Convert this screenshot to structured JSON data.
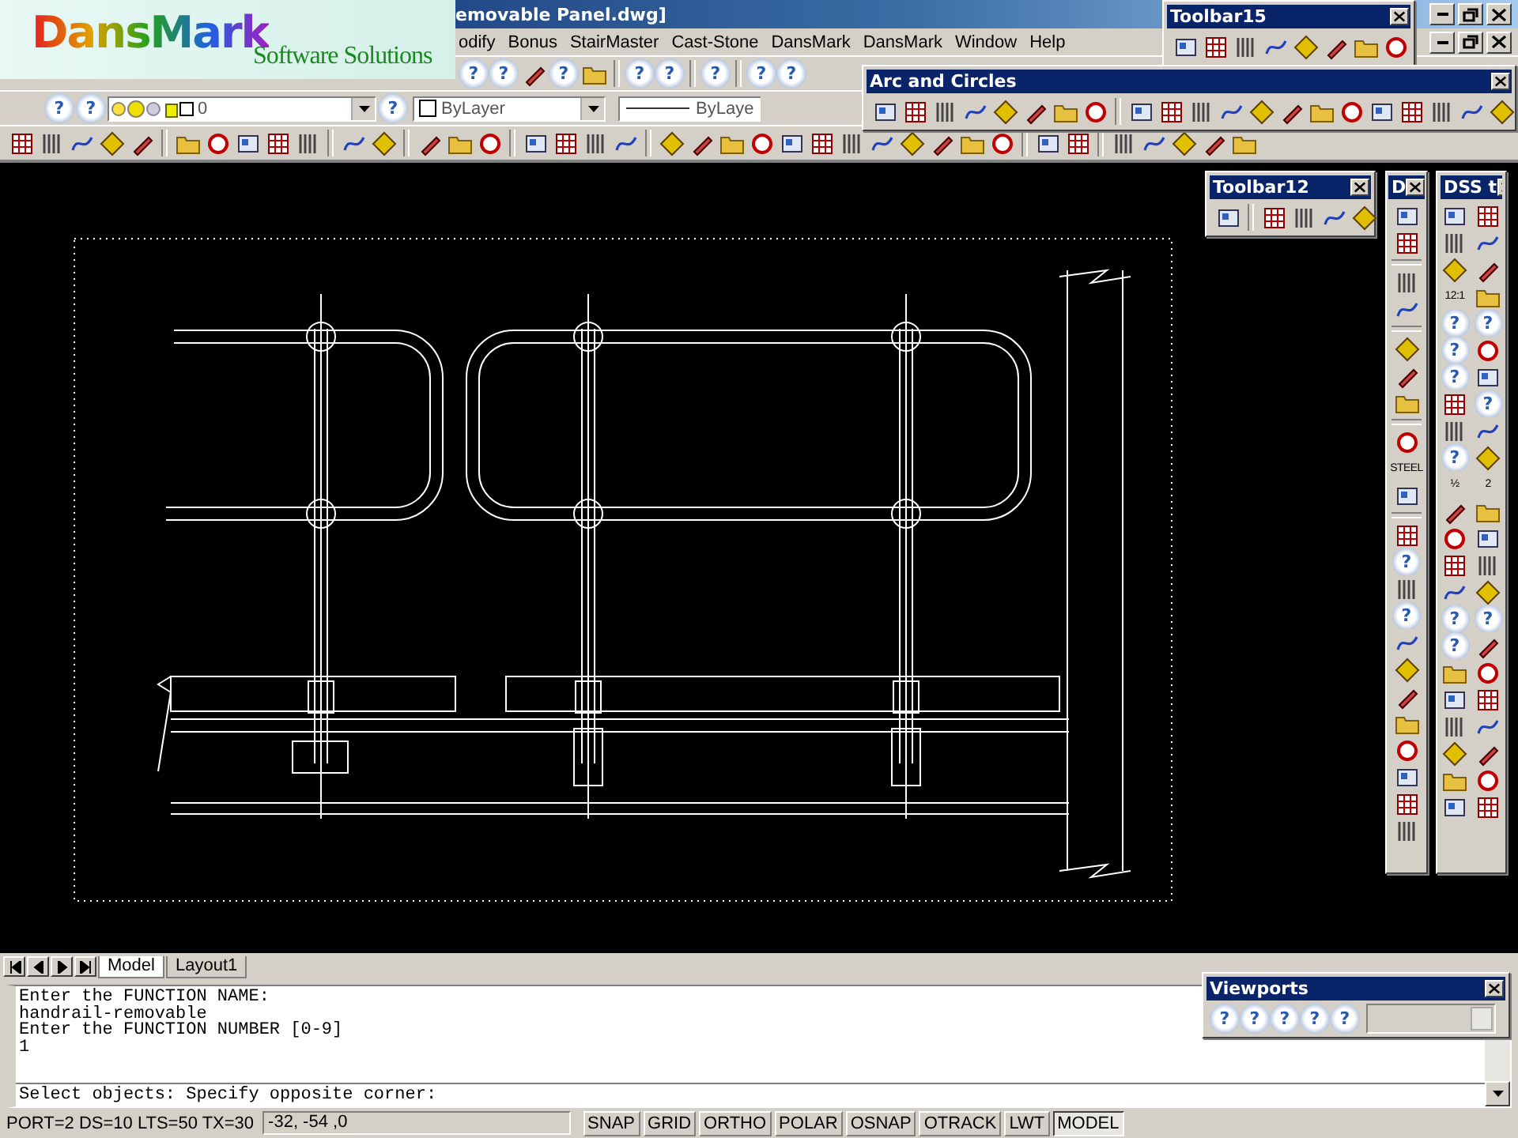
{
  "logo_overlay": {
    "brand": "DansMark",
    "tagline": "Software Solutions"
  },
  "window": {
    "title": "emovable Panel.dwg]"
  },
  "menu": [
    "odify",
    "Bonus",
    "StairMaster",
    "Cast-Stone",
    "DansMark",
    "DansMark",
    "Window",
    "Help"
  ],
  "standard_toolbar": {
    "items": [
      {
        "kind": "help",
        "label": "?"
      },
      {
        "kind": "help",
        "label": "?"
      },
      {
        "kind": "tool"
      },
      {
        "kind": "help",
        "label": "?"
      },
      {
        "kind": "tool"
      },
      {
        "kind": "sep"
      },
      {
        "kind": "help",
        "label": "?"
      },
      {
        "kind": "help",
        "label": "?"
      },
      {
        "kind": "sep"
      },
      {
        "kind": "help",
        "label": "?"
      },
      {
        "kind": "sep"
      },
      {
        "kind": "help",
        "label": "?"
      },
      {
        "kind": "help",
        "label": "?"
      }
    ]
  },
  "layers_toolbar": {
    "buttons": [
      "?",
      "?"
    ],
    "layer": "0",
    "color_button": "?",
    "color_setting": "ByLayer",
    "linetype": "ByLaye"
  },
  "draw_toolbar": {
    "items": [
      {
        "kind": "tool"
      },
      {
        "kind": "tool"
      },
      {
        "kind": "tool"
      },
      {
        "kind": "tool"
      },
      {
        "kind": "tool"
      },
      {
        "kind": "sep"
      },
      {
        "kind": "tool"
      },
      {
        "kind": "tool"
      },
      {
        "kind": "tool"
      },
      {
        "kind": "tool"
      },
      {
        "kind": "tool"
      },
      {
        "kind": "sep"
      },
      {
        "kind": "tool"
      },
      {
        "kind": "tool"
      },
      {
        "kind": "sep"
      },
      {
        "kind": "tool"
      },
      {
        "kind": "tool"
      },
      {
        "kind": "tool"
      },
      {
        "kind": "sep"
      },
      {
        "kind": "tool"
      },
      {
        "kind": "tool"
      },
      {
        "kind": "tool"
      },
      {
        "kind": "tool"
      },
      {
        "kind": "sep"
      },
      {
        "kind": "tool"
      },
      {
        "kind": "tool"
      },
      {
        "kind": "tool"
      },
      {
        "kind": "tool"
      },
      {
        "kind": "tool"
      },
      {
        "kind": "tool"
      },
      {
        "kind": "tool"
      },
      {
        "kind": "tool"
      },
      {
        "kind": "tool"
      },
      {
        "kind": "tool"
      },
      {
        "kind": "tool"
      },
      {
        "kind": "tool"
      },
      {
        "kind": "sep"
      },
      {
        "kind": "tool"
      },
      {
        "kind": "tool"
      },
      {
        "kind": "sep"
      },
      {
        "kind": "tool"
      },
      {
        "kind": "tool"
      },
      {
        "kind": "tool"
      },
      {
        "kind": "tool"
      },
      {
        "kind": "tool"
      }
    ]
  },
  "floating_toolbars": [
    {
      "title": "Toolbar15",
      "items": [
        {
          "kind": "tool"
        },
        {
          "kind": "tool"
        },
        {
          "kind": "tool"
        },
        {
          "kind": "tool"
        },
        {
          "kind": "tool"
        },
        {
          "kind": "tool"
        },
        {
          "kind": "tool"
        },
        {
          "kind": "tool"
        }
      ]
    },
    {
      "title": "Arc and Circles",
      "items": [
        {
          "kind": "tool"
        },
        {
          "kind": "tool"
        },
        {
          "kind": "tool"
        },
        {
          "kind": "tool"
        },
        {
          "kind": "tool"
        },
        {
          "kind": "tool"
        },
        {
          "kind": "tool"
        },
        {
          "kind": "tool"
        },
        {
          "kind": "sep"
        },
        {
          "kind": "tool"
        },
        {
          "kind": "tool"
        },
        {
          "kind": "tool"
        },
        {
          "kind": "tool"
        },
        {
          "kind": "tool"
        },
        {
          "kind": "tool"
        },
        {
          "kind": "tool"
        },
        {
          "kind": "tool"
        },
        {
          "kind": "tool"
        },
        {
          "kind": "tool"
        },
        {
          "kind": "tool"
        },
        {
          "kind": "tool"
        },
        {
          "kind": "tool"
        }
      ]
    },
    {
      "title": "Toolbar12",
      "items": [
        {
          "kind": "tool"
        },
        {
          "kind": "sep"
        },
        {
          "kind": "tool"
        },
        {
          "kind": "tool"
        },
        {
          "kind": "tool"
        },
        {
          "kind": "tool"
        }
      ]
    },
    {
      "title": "D",
      "items": [
        {
          "kind": "tool"
        },
        {
          "kind": "tool"
        },
        {
          "kind": "sep"
        },
        {
          "kind": "tool"
        },
        {
          "kind": "tool"
        },
        {
          "kind": "sep"
        },
        {
          "kind": "tool"
        },
        {
          "kind": "tool"
        },
        {
          "kind": "tool"
        },
        {
          "kind": "sep"
        },
        {
          "kind": "tool"
        },
        {
          "kind": "text",
          "label": "STEEL"
        },
        {
          "kind": "tool"
        },
        {
          "kind": "sep"
        },
        {
          "kind": "tool"
        },
        {
          "kind": "help",
          "label": "?"
        },
        {
          "kind": "tool"
        },
        {
          "kind": "help",
          "label": "?"
        },
        {
          "kind": "tool"
        },
        {
          "kind": "tool"
        },
        {
          "kind": "tool"
        },
        {
          "kind": "tool"
        },
        {
          "kind": "tool"
        },
        {
          "kind": "tool"
        },
        {
          "kind": "tool"
        },
        {
          "kind": "tool"
        }
      ]
    },
    {
      "title": "DSS t",
      "items": [
        {
          "kind": "tool"
        },
        {
          "kind": "tool"
        },
        {
          "kind": "tool"
        },
        {
          "kind": "tool"
        },
        {
          "kind": "tool"
        },
        {
          "kind": "tool"
        },
        {
          "kind": "text",
          "label": "12:1"
        },
        {
          "kind": "tool"
        },
        {
          "kind": "help",
          "label": "?"
        },
        {
          "kind": "help",
          "label": "?"
        },
        {
          "kind": "help",
          "label": "?"
        },
        {
          "kind": "tool"
        },
        {
          "kind": "help",
          "label": "?"
        },
        {
          "kind": "tool"
        },
        {
          "kind": "tool"
        },
        {
          "kind": "help",
          "label": "?"
        },
        {
          "kind": "tool"
        },
        {
          "kind": "tool"
        },
        {
          "kind": "help",
          "label": "?"
        },
        {
          "kind": "tool"
        },
        {
          "kind": "text",
          "label": "½"
        },
        {
          "kind": "text",
          "label": "2"
        },
        {
          "kind": "tool"
        },
        {
          "kind": "tool"
        },
        {
          "kind": "tool"
        },
        {
          "kind": "tool"
        },
        {
          "kind": "tool"
        },
        {
          "kind": "tool"
        },
        {
          "kind": "tool"
        },
        {
          "kind": "tool"
        },
        {
          "kind": "help",
          "label": "?"
        },
        {
          "kind": "help",
          "label": "?"
        },
        {
          "kind": "help",
          "label": "?"
        },
        {
          "kind": "tool"
        },
        {
          "kind": "tool"
        },
        {
          "kind": "tool"
        },
        {
          "kind": "tool"
        },
        {
          "kind": "tool"
        },
        {
          "kind": "tool"
        },
        {
          "kind": "tool"
        },
        {
          "kind": "tool"
        },
        {
          "kind": "tool"
        },
        {
          "kind": "tool"
        },
        {
          "kind": "tool"
        },
        {
          "kind": "tool"
        },
        {
          "kind": "tool"
        }
      ]
    },
    {
      "title": "Viewports",
      "items": [
        {
          "kind": "help",
          "label": "?"
        },
        {
          "kind": "help",
          "label": "?"
        },
        {
          "kind": "help",
          "label": "?"
        },
        {
          "kind": "help",
          "label": "?"
        },
        {
          "kind": "help",
          "label": "?"
        },
        {
          "kind": "combo"
        }
      ]
    }
  ],
  "layout_tabs": [
    {
      "label": "Model",
      "selected": true
    },
    {
      "label": "Layout1",
      "selected": false
    }
  ],
  "command_history": [
    "Enter the FUNCTION NAME:",
    "handrail-removable",
    "Enter the FUNCTION NUMBER [0-9]",
    "1"
  ],
  "command_prompt": "Select objects: Specify opposite corner:",
  "status_bar": {
    "variables": "PORT=2 DS=10 LTS=50 TX=30",
    "coordinates": "-32, -54 ,0",
    "toggles": [
      {
        "label": "SNAP",
        "on": false
      },
      {
        "label": "GRID",
        "on": false
      },
      {
        "label": "ORTHO",
        "on": false
      },
      {
        "label": "POLAR",
        "on": false
      },
      {
        "label": "OSNAP",
        "on": false
      },
      {
        "label": "OTRACK",
        "on": false
      },
      {
        "label": "LWT",
        "on": false
      },
      {
        "label": "MODEL",
        "on": true
      }
    ]
  }
}
